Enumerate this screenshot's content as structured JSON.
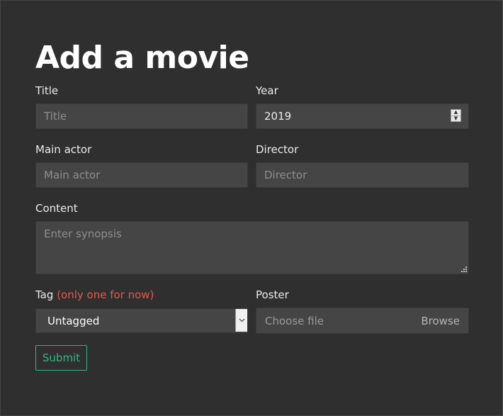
{
  "form": {
    "heading": "Add a movie",
    "title": {
      "label": "Title",
      "placeholder": "Title"
    },
    "year": {
      "label": "Year",
      "value": "2019"
    },
    "main_actor": {
      "label": "Main actor",
      "placeholder": "Main actor"
    },
    "director": {
      "label": "Director",
      "placeholder": "Director"
    },
    "content": {
      "label": "Content",
      "placeholder": "Enter synopsis"
    },
    "tag": {
      "label": "Tag",
      "hint": "(only one for now)",
      "selected": "Untagged",
      "hint_color": "#e05b4d"
    },
    "poster": {
      "label": "Poster",
      "file_text": "Choose file",
      "browse_label": "Browse"
    },
    "submit_label": "Submit",
    "accent_color": "#2fb882"
  }
}
